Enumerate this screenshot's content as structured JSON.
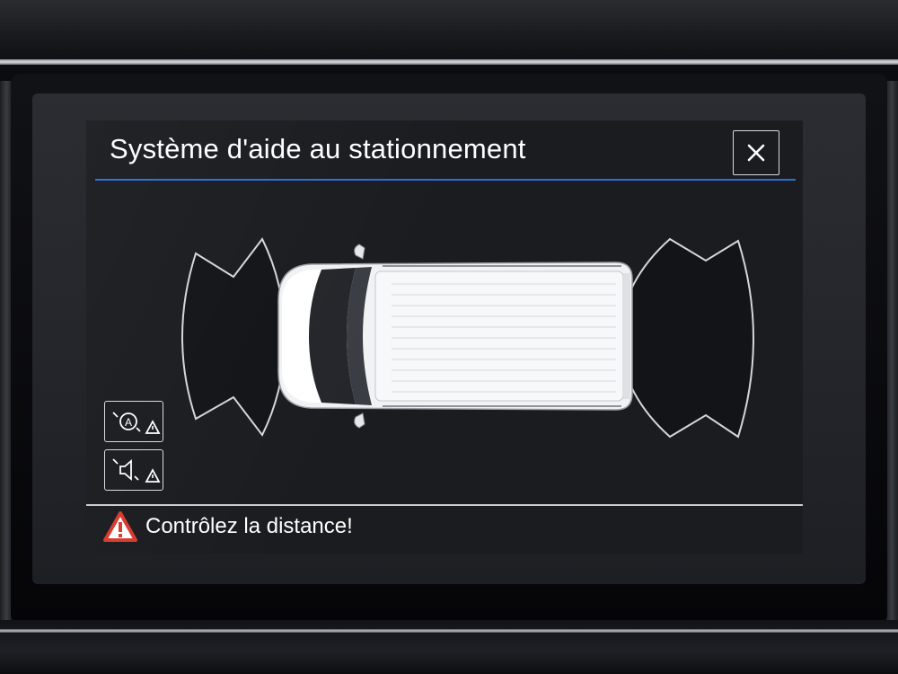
{
  "header": {
    "title": "Système d'aide au stationnement",
    "close_icon": "close-icon"
  },
  "scene": {
    "vehicle": "van-top-view",
    "front_sensor_zone": "front-sensor-arc",
    "rear_sensor_zone": "rear-sensor-arc"
  },
  "side_buttons": [
    {
      "icon": "auto-activation-icon"
    },
    {
      "icon": "sound-mute-icon"
    }
  ],
  "footer": {
    "warning_icon": "warning-triangle-icon",
    "message": "Contrôlez la distance!"
  },
  "colors": {
    "accent_line": "#2b6fd6",
    "warning_red": "#d83a2e",
    "screen_bg": "#1a1c20"
  }
}
